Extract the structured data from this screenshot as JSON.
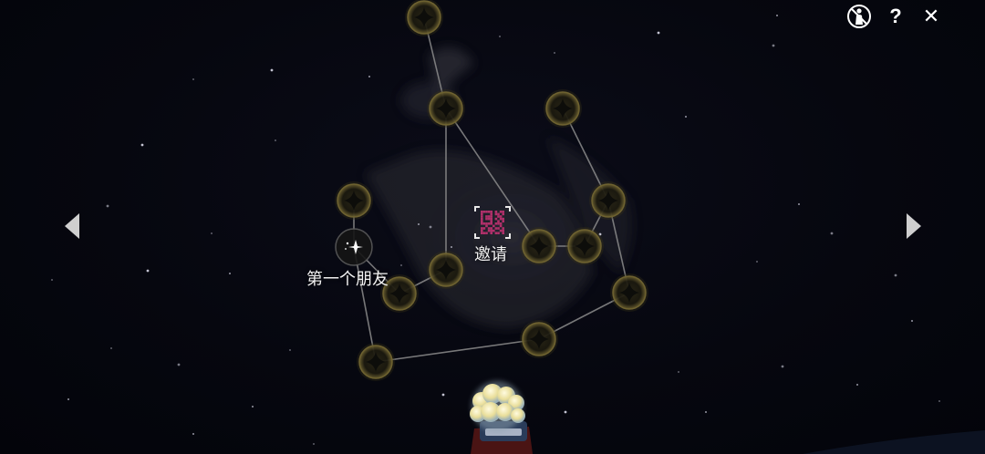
{
  "constellation": {
    "first_friend_label": "第一个朋友",
    "invite_label": "邀请"
  },
  "icons": {
    "top_bar": [
      "no-pose-person-icon",
      "help-icon",
      "close-icon"
    ],
    "navigation": [
      "chevron-left-icon",
      "chevron-right-icon"
    ],
    "nodes": [
      "sparkle-icon",
      "star-node-icon",
      "qr-code-icon"
    ]
  },
  "top_bar": {
    "help_symbol": "?",
    "close_symbol": "✕"
  },
  "colors": {
    "background": "#05060d",
    "star_node_glow": "#8a7a3a",
    "constellation_line": "#9a9a9a",
    "qr_code": "#b0306a",
    "icon_white": "#ffffff"
  }
}
